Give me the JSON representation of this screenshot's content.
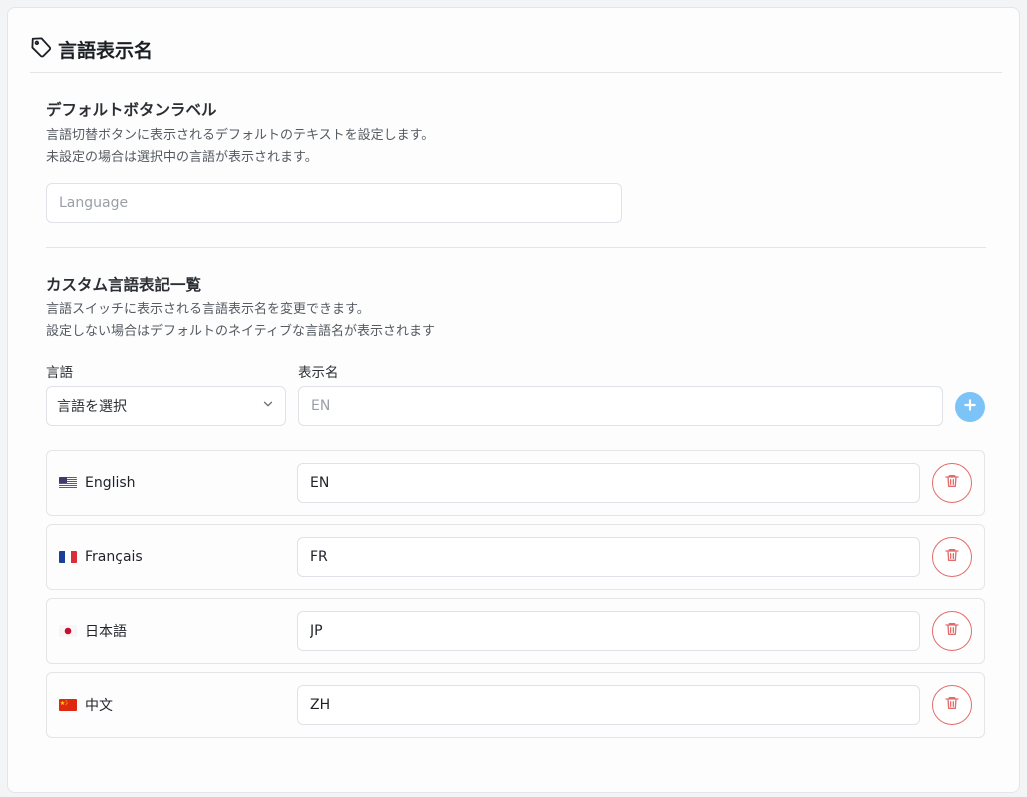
{
  "header": {
    "title": "言語表示名",
    "icon": "tag-icon"
  },
  "default_label": {
    "title": "デフォルトボタンラベル",
    "desc_line1": "言語切替ボタンに表示されるデフォルトのテキストを設定します。",
    "desc_line2": "未設定の場合は選択中の言語が表示されます。",
    "input_value": "",
    "input_placeholder": "Language"
  },
  "custom_list": {
    "title": "カスタム言語表記一覧",
    "desc_line1": "言語スイッチに表示される言語表示名を変更できます。",
    "desc_line2": "設定しない場合はデフォルトのネイティブな言語名が表示されます",
    "language_label": "言語",
    "display_label": "表示名",
    "select_value": "言語を選択",
    "display_placeholder": "EN",
    "colors": {
      "add": "#7cc4f8",
      "delete": "#e26c6c"
    },
    "rows": [
      {
        "flag": "us-flag-icon",
        "name": "English",
        "value": "EN"
      },
      {
        "flag": "fr-flag-icon",
        "name": "Français",
        "value": "FR"
      },
      {
        "flag": "jp-flag-icon",
        "name": "日本語",
        "value": "JP"
      },
      {
        "flag": "cn-flag-icon",
        "name": "中文",
        "value": "ZH"
      }
    ]
  }
}
